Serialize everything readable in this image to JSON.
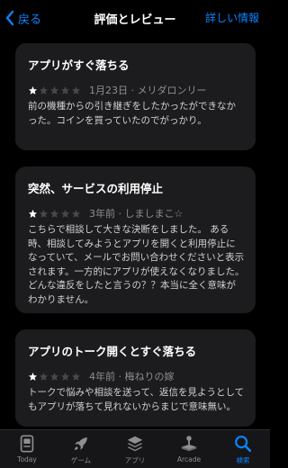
{
  "nav": {
    "back_label": "戻る",
    "title": "評価とレビュー",
    "right_label": "詳しい情報"
  },
  "reviews": [
    {
      "title": "アプリがすぐ落ちる",
      "rating": 1,
      "max_rating": 5,
      "meta": "1月23日 · メリダロンリー",
      "body": "前の機種からの引き継ぎをしたかったができなかった。コインを買っていたのでがっかり。"
    },
    {
      "title": "突然、サービスの利用停止",
      "rating": 1,
      "max_rating": 5,
      "meta": "3年前 · しましまこ☆",
      "body": "こちらで相談して大きな決断をしました。 ある時、相談してみようとアプリを開くと利用停止になっていて、メールでお問い合わせくださいと表示されます。一方的にアプリが使えなくなりました。どんな違反をしたと言うの？？本当に全く意味がわかりません。"
    },
    {
      "title": "アプリのトーク開くとすぐ落ちる",
      "rating": 1,
      "max_rating": 5,
      "meta": "4年前 · 梅ねりの嫁",
      "body": "トークで悩みや相談を送って、返信を見ようとしてもアプリが落ちて見れないからまじで意味無い。"
    }
  ],
  "tabs": [
    {
      "label": "Today",
      "icon": "today-icon"
    },
    {
      "label": "ゲーム",
      "icon": "rocket-icon"
    },
    {
      "label": "アプリ",
      "icon": "apps-stack-icon"
    },
    {
      "label": "Arcade",
      "icon": "joystick-icon"
    },
    {
      "label": "検索",
      "icon": "search-icon",
      "active": true
    }
  ],
  "colors": {
    "accent": "#0a84ff",
    "card_bg": "#1c1c1e",
    "background": "#000000"
  }
}
